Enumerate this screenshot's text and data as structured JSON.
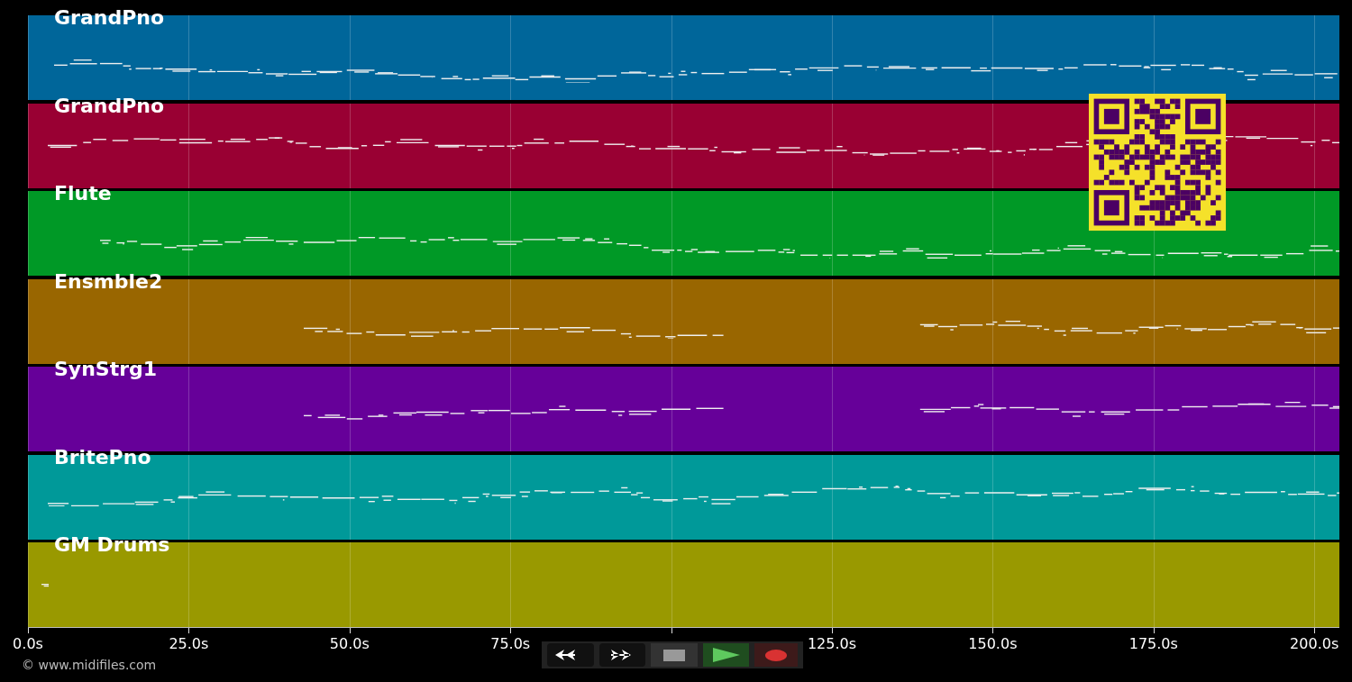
{
  "tracks": [
    {
      "name": "GrandPno",
      "color": "#00669a"
    },
    {
      "name": "GrandPno",
      "color": "#990033"
    },
    {
      "name": "Flute",
      "color": "#009926"
    },
    {
      "name": "Ensmble2",
      "color": "#996600"
    },
    {
      "name": "SynStrg1",
      "color": "#660099"
    },
    {
      "name": "BritePno",
      "color": "#009999"
    },
    {
      "name": "GM Drums",
      "color": "#999900"
    }
  ],
  "axis": {
    "labels_left_of_transport": [
      "0.0s",
      "25.0s",
      "50.0s",
      "75.0s"
    ],
    "labels_right_of_transport": [
      "125.0s",
      "150.0s",
      "175.0s",
      "200.0s"
    ]
  },
  "credit": "© www.midifiles.com",
  "transport": [
    {
      "kind": "rewind"
    },
    {
      "kind": "forward"
    },
    {
      "kind": "stop"
    },
    {
      "kind": "play"
    },
    {
      "kind": "record"
    }
  ]
}
